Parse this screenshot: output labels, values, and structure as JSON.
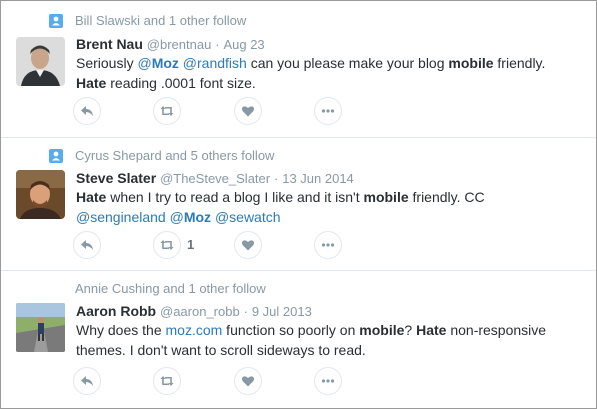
{
  "colors": {
    "link": "#2b7bb9",
    "muted": "#8899a6",
    "text": "#292f33",
    "divider": "#e1e8ed",
    "context_icon": "#55acee"
  },
  "tweets": [
    {
      "context": "Bill Slawski and 1 other follow",
      "fullname": "Brent Nau",
      "username": "@brentnau",
      "dot": "·",
      "time": "Aug 23",
      "body": {
        "t1": "Seriously ",
        "m1_at": "@",
        "m1_name": "Moz",
        "t2": " ",
        "m2": "@randfish",
        "t3": " can you please make your blog ",
        "b1": "mobile",
        "t4": " friendly.",
        "b2": "Hate",
        "t5": " reading .0001 font size."
      },
      "retweet_count": ""
    },
    {
      "context": "Cyrus Shepard and 5 others follow",
      "fullname": "Steve Slater",
      "username": "@TheSteve_Slater",
      "dot": "·",
      "time": "13 Jun 2014",
      "body": {
        "b1": "Hate",
        "t1": " when I try to read a blog I like and it isn't ",
        "b2": "mobile",
        "t2": " friendly. CC",
        "m1": "@sengineland",
        "m2_at": "@",
        "m2_name": "Moz",
        "m3": "@sewatch"
      },
      "retweet_count": "1"
    },
    {
      "context": "Annie Cushing and 1 other follow",
      "fullname": "Aaron Robb",
      "username": "@aaron_robb",
      "dot": "·",
      "time": "9 Jul 2013",
      "body": {
        "t1": "Why does the ",
        "link": "moz.com",
        "t2": " function so poorly on ",
        "b1": "mobile",
        "t3": "? ",
        "b2": "Hate",
        "t4": " non-responsive",
        "t5": "themes. I don't want to scroll sideways to read."
      },
      "retweet_count": ""
    }
  ],
  "icons": [
    "person-follow-icon",
    "reply-icon",
    "retweet-icon",
    "like-heart-icon",
    "more-dots-icon"
  ]
}
